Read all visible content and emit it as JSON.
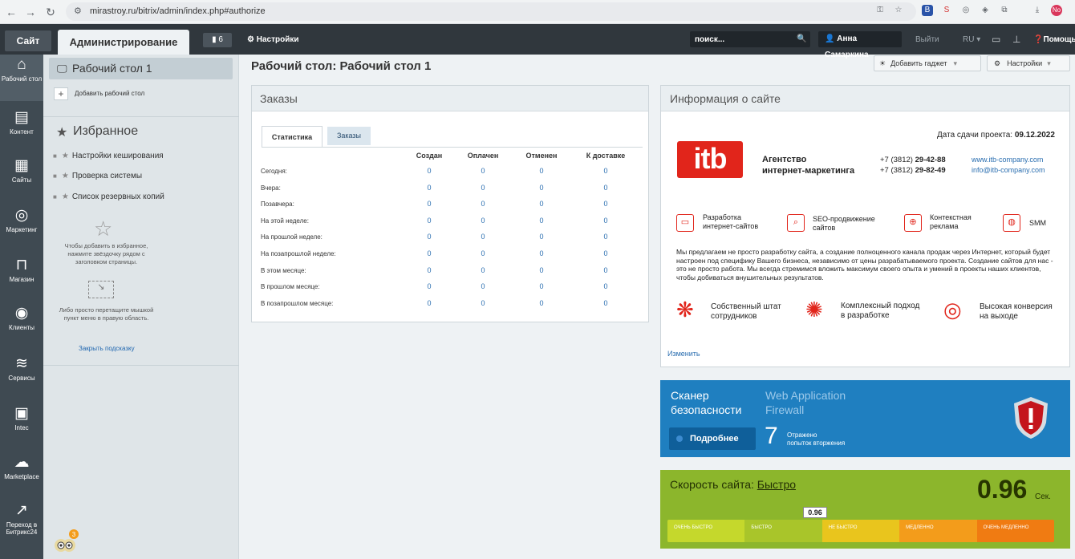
{
  "browser": {
    "url": "mirastroy.ru/bitrix/admin/index.php#authorize"
  },
  "adminbar": {
    "site_tab": "Сайт",
    "admin_tab": "Администрирование",
    "notif_count": "6",
    "settings": "Настройки",
    "search_placeholder": "поиск...",
    "user": "Анна Самаркина",
    "logout": "Выйти",
    "lang": "RU",
    "help": "Помощь"
  },
  "leftnav": {
    "items": [
      {
        "label": "Рабочий стол",
        "icon": "home-icon"
      },
      {
        "label": "Контент",
        "icon": "document-icon"
      },
      {
        "label": "Сайты",
        "icon": "calendar-icon"
      },
      {
        "label": "Маркетинг",
        "icon": "target-icon"
      },
      {
        "label": "Магазин",
        "icon": "basket-icon"
      },
      {
        "label": "Клиенты",
        "icon": "clients-icon"
      },
      {
        "label": "Сервисы",
        "icon": "layers-icon"
      },
      {
        "label": "Intec",
        "icon": "intec-icon"
      },
      {
        "label": "Marketplace",
        "icon": "cloud-icon"
      },
      {
        "label": "Переход в Битрикс24",
        "icon": "bitrix24-icon"
      }
    ]
  },
  "sidebar": {
    "desktop": "Рабочий стол 1",
    "add_desktop": "Добавить рабочий стол",
    "favorites_title": "Избранное",
    "favorites": [
      "Настройки кеширования",
      "Проверка системы",
      "Список резервных копий"
    ],
    "hint1": "Чтобы добавить в избранное, нажмите звёздочку рядом с заголовком страницы.",
    "hint2": "Либо просто перетащите мышкой пункт меню в правую область.",
    "close_hint": "Закрыть подсказку",
    "mascot_badge": "3"
  },
  "main": {
    "title": "Рабочий стол: Рабочий стол 1",
    "add_gadget": "Добавить гаджет",
    "settings": "Настройки"
  },
  "orders": {
    "title": "Заказы",
    "tabs": [
      "Статистика",
      "Заказы"
    ],
    "columns": [
      "Создан",
      "Оплачен",
      "Отменен",
      "К доставке"
    ],
    "rows": [
      {
        "label": "Сегодня:",
        "values": [
          "0",
          "0",
          "0",
          "0"
        ]
      },
      {
        "label": "Вчера:",
        "values": [
          "0",
          "0",
          "0",
          "0"
        ]
      },
      {
        "label": "Позавчера:",
        "values": [
          "0",
          "0",
          "0",
          "0"
        ]
      },
      {
        "label": "На этой неделе:",
        "values": [
          "0",
          "0",
          "0",
          "0"
        ]
      },
      {
        "label": "На прошлой неделе:",
        "values": [
          "0",
          "0",
          "0",
          "0"
        ]
      },
      {
        "label": "На позапрошлой неделе:",
        "values": [
          "0",
          "0",
          "0",
          "0"
        ]
      },
      {
        "label": "В этом месяце:",
        "values": [
          "0",
          "0",
          "0",
          "0"
        ]
      },
      {
        "label": "В прошлом месяце:",
        "values": [
          "0",
          "0",
          "0",
          "0"
        ]
      },
      {
        "label": "В позапрошлом месяце:",
        "values": [
          "0",
          "0",
          "0",
          "0"
        ]
      }
    ]
  },
  "info": {
    "title": "Информация о сайте",
    "deadline_label": "Дата сдачи проекта:",
    "deadline_date": "09.12.2022",
    "logo": "itb",
    "agency_line1": "Агентство",
    "agency_line2": "интернет-маркетинга",
    "phone1_prefix": "+7 (3812)",
    "phone1": "29-42-88",
    "phone2_prefix": "+7 (3812)",
    "phone2": "29-82-49",
    "site": "www.itb-company.com",
    "email": "info@itb-company.com",
    "services": [
      {
        "l1": "Разработка",
        "l2": "интернет-сайтов"
      },
      {
        "l1": "SEO-продвижение",
        "l2": "сайтов"
      },
      {
        "l1": "Контекстная",
        "l2": "реклама"
      },
      {
        "l1": "SMM",
        "l2": ""
      }
    ],
    "description": "Мы предлагаем не просто разработку сайта, а создание полноценного канала продаж через Интернет, который будет настроен под специфику Вашего бизнеса, независимо от цены разрабатываемого проекта. Создание сайтов для нас - это не просто работа. Мы всегда стремимся вложить максимум своего опыта и умений в проекты наших клиентов, чтобы добиваться внушительных результатов.",
    "features": [
      {
        "l1": "Собственный штат",
        "l2": "сотрудников"
      },
      {
        "l1": "Комплексный подход",
        "l2": "в разработке"
      },
      {
        "l1": "Высокая конверсия",
        "l2": "на выходе"
      }
    ],
    "edit": "Изменить"
  },
  "security": {
    "title_l1": "Сканер",
    "title_l2": "безопасности",
    "waf_l1": "Web Application",
    "waf_l2": "Firewall",
    "more": "Подробнее",
    "count": "7",
    "count_l1": "Отражено",
    "count_l2": "попыток вторжения"
  },
  "speed": {
    "title": "Скорость сайта:",
    "rating": "Быстро",
    "value": "0.96",
    "unit": "Сек.",
    "marker": "0.96",
    "scale": [
      "ОЧЕНЬ БЫСТРО",
      "БЫСТРО",
      "НЕ БЫСТРО",
      "МЕДЛЕННО",
      "ОЧЕНЬ МЕДЛЕННО"
    ],
    "colors": [
      "#c5d82c",
      "#a9c52a",
      "#e9c51d",
      "#f39c1b",
      "#f07b12"
    ]
  }
}
